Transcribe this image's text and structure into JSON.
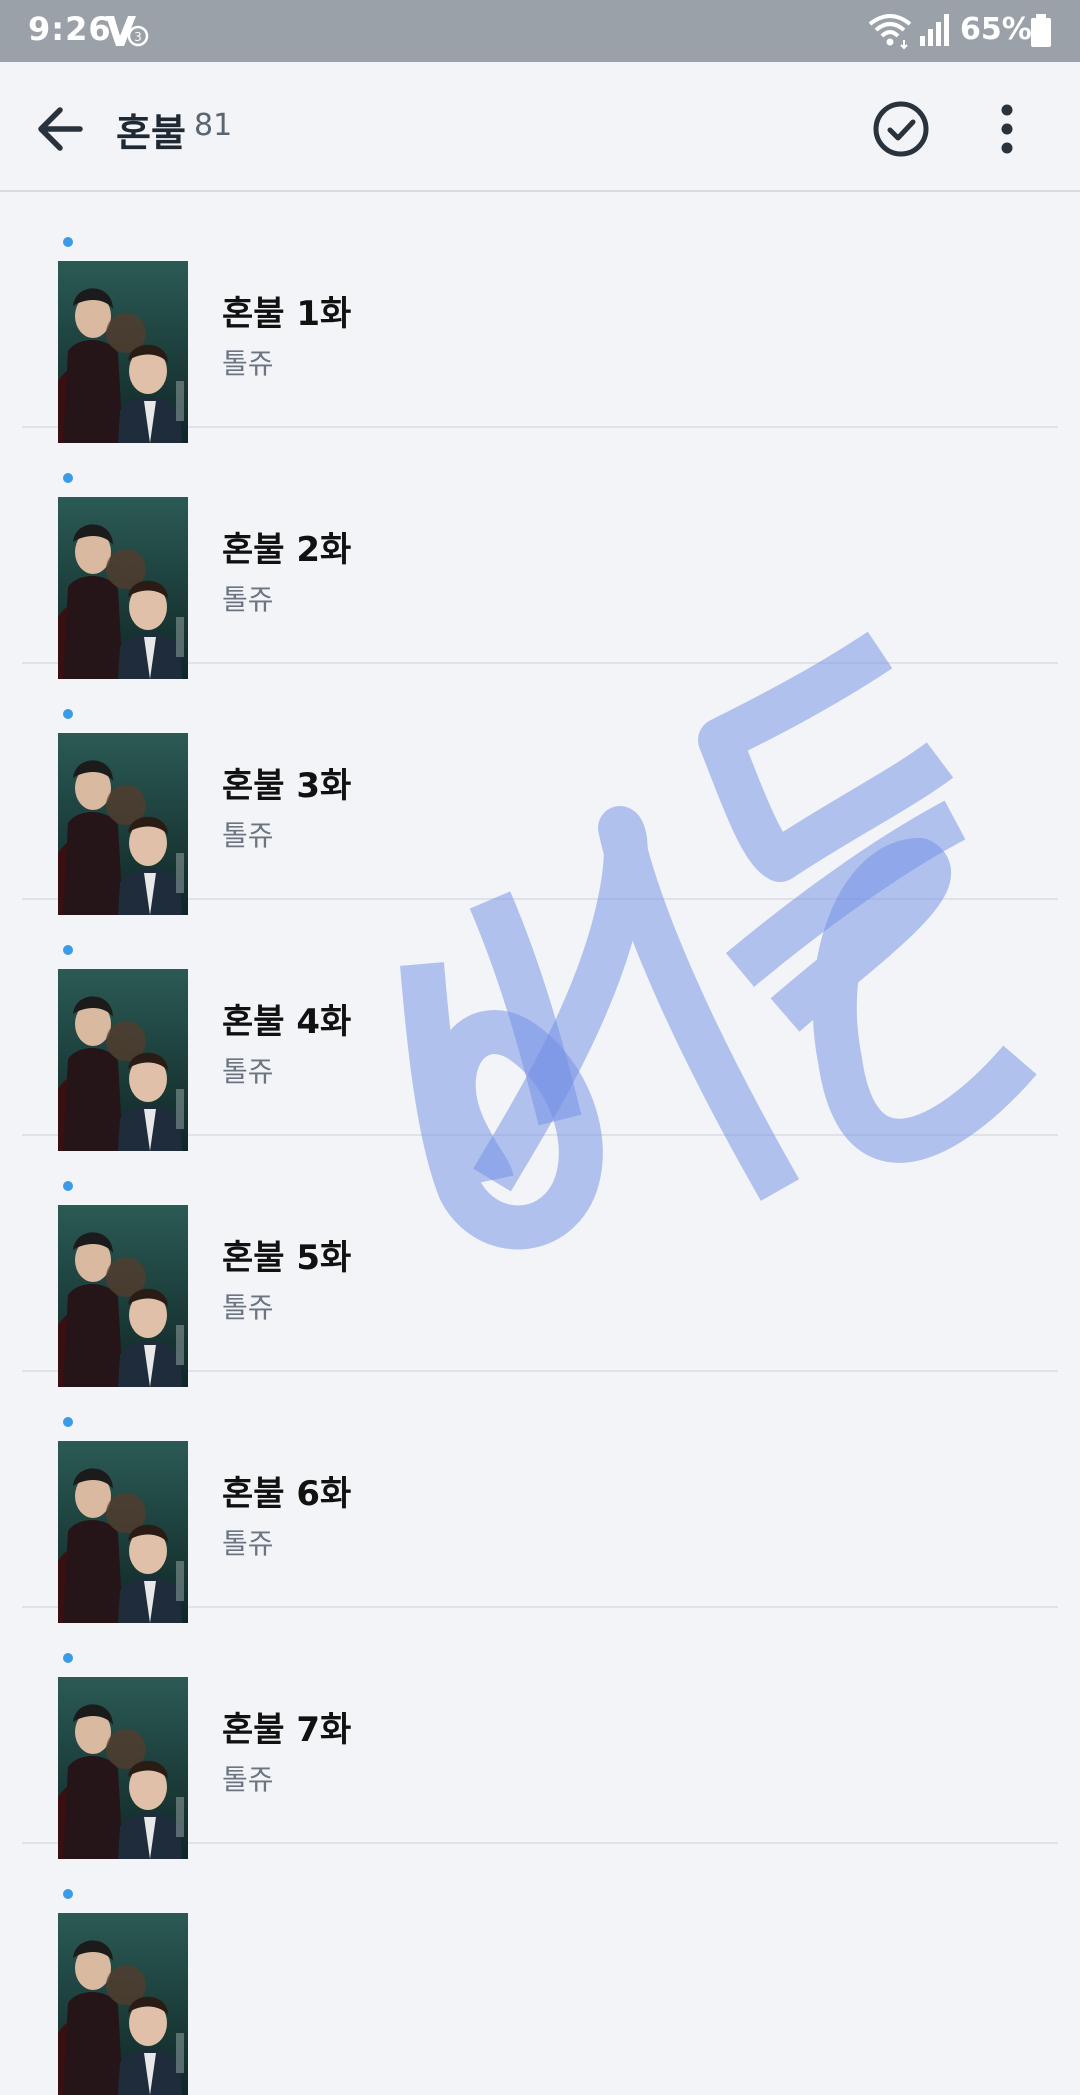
{
  "status_bar": {
    "time": "9:26",
    "battery": "65%",
    "icons": [
      "app-notification-icon",
      "wifi-icon",
      "signal-icon",
      "battery-icon"
    ]
  },
  "app_bar": {
    "title": "혼불",
    "count": "81",
    "icons": [
      "back-arrow-icon",
      "check-circle-icon",
      "more-vert-icon"
    ]
  },
  "episodes": [
    {
      "title": "혼불 1화",
      "author": "톨쥬"
    },
    {
      "title": "혼불 2화",
      "author": "톨쥬"
    },
    {
      "title": "혼불 3화",
      "author": "톨쥬"
    },
    {
      "title": "혼불 4화",
      "author": "톨쥬"
    },
    {
      "title": "혼불 5화",
      "author": "톨쥬"
    },
    {
      "title": "혼불 6화",
      "author": "톨쥬"
    },
    {
      "title": "혼불 7화",
      "author": "톨쥬"
    }
  ],
  "colors": {
    "status_bar": "#9ba1a8",
    "background": "#f2f4f7",
    "new_dot": "#3b9be6",
    "scribble": "#6f8ee6"
  }
}
